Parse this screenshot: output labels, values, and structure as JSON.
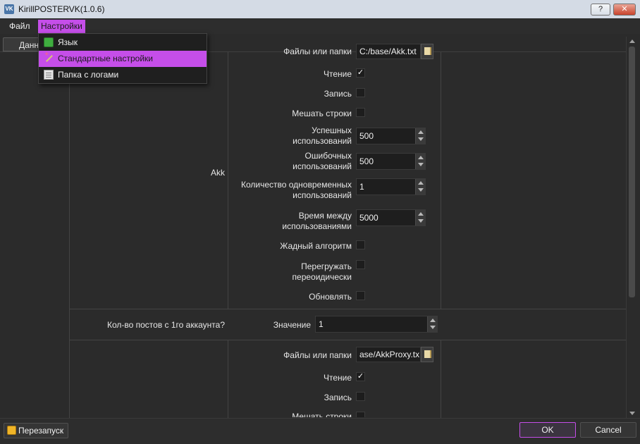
{
  "window": {
    "title": "KirillPOSTERVK(1.0.6)",
    "help_label": "?",
    "close_label": "✕",
    "app_icon_label": "VK"
  },
  "menubar": {
    "file_label": "Файл",
    "settings_label": "Настройки"
  },
  "tab": {
    "data_label": "Данн"
  },
  "dropdown": {
    "items": [
      {
        "label": "Язык",
        "icon": "language-icon"
      },
      {
        "label": "Стандартные настройки",
        "icon": "magic-wand-icon"
      },
      {
        "label": "Папка с логами",
        "icon": "log-folder-icon"
      }
    ]
  },
  "akk_section": {
    "group_label": "Akk",
    "files_label": "Файлы или папки",
    "files_value": "C:/base/Akk.txt",
    "read_label": "Чтение",
    "read_checked": "✓",
    "write_label": "Запись",
    "shuffle_label": "Мешать строки",
    "success_label_1": "Успешных",
    "success_label_2": "использований",
    "success_value": "500",
    "error_label_1": "Ошибочных",
    "error_label_2": "использований",
    "error_value": "500",
    "simultaneous_label_1": "Количество одновременных",
    "simultaneous_label_2": "использований",
    "simultaneous_value": "1",
    "interval_label_1": "Время между",
    "interval_label_2": "использованиями",
    "interval_value": "5000",
    "greedy_label": "Жадный алгоритм",
    "reload_label_1": "Перегружать",
    "reload_label_2": "переоидически",
    "update_label": "Обновлять"
  },
  "posts_section": {
    "group_label": "Кол-во постов с 1го аккаунта?",
    "value_label": "Значение",
    "value": "1"
  },
  "proxy_section": {
    "files_label": "Файлы или папки",
    "files_value": "ase/AkkProxy.tx",
    "read_label": "Чтение",
    "read_checked": "✓",
    "write_label": "Запись",
    "shuffle_label": "Мешать строки"
  },
  "bottombar": {
    "restart_label": "Перезапуск",
    "ok_label": "OK",
    "cancel_label": "Cancel"
  },
  "colors": {
    "accent": "#c54ee9",
    "background": "#2b2b2b",
    "field_bg": "#1e1e1e"
  }
}
